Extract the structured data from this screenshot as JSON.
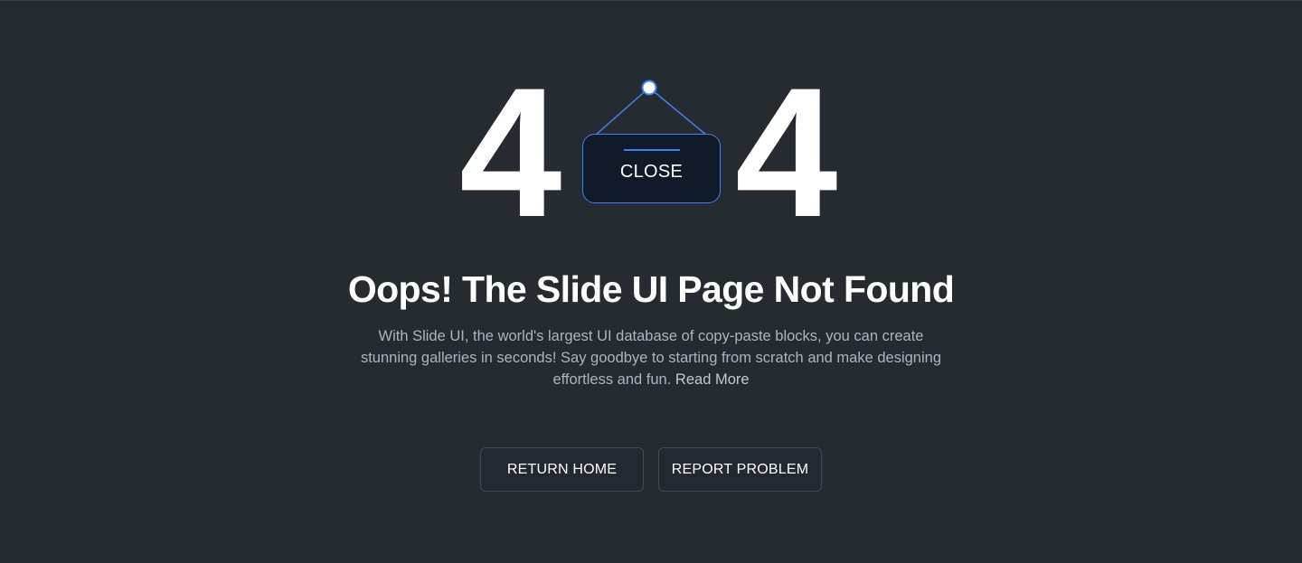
{
  "error": {
    "digit_left": "4",
    "digit_right": "4",
    "sign_label": "CLOSE"
  },
  "content": {
    "headline": "Oops! The Slide UI Page Not Found",
    "description": "With Slide UI, the world's largest UI database of copy-paste blocks, you can create stunning galleries in seconds! Say goodbye to starting from scratch and make designing effortless and fun.",
    "read_more": "Read More"
  },
  "actions": {
    "return_home": "RETURN HOME",
    "report_problem": "REPORT PROBLEM"
  },
  "colors": {
    "background": "#262b31",
    "accent": "#3b82f6",
    "sign_board": "#121a29",
    "text_primary": "#ffffff",
    "text_muted": "#aeb4bd"
  }
}
